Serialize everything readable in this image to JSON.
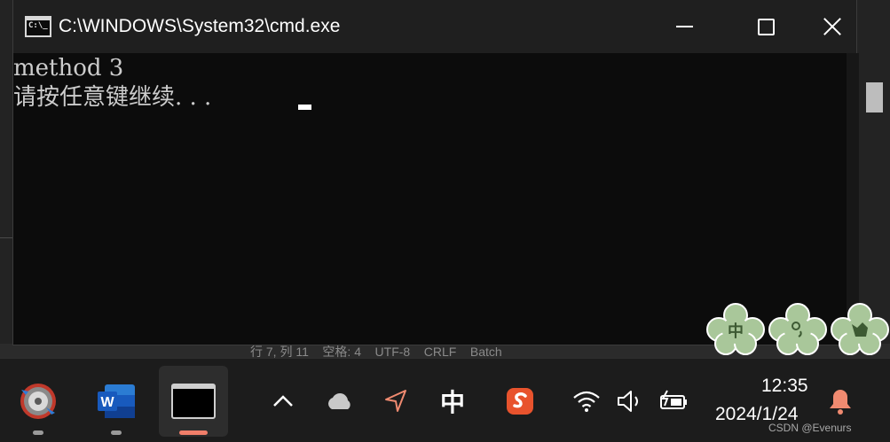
{
  "window": {
    "title": "C:\\WINDOWS\\System32\\cmd.exe",
    "icon_text": "C:\\_",
    "icon": "console-icon",
    "controls": [
      "minimize-icon",
      "maximize-icon",
      "close-icon"
    ]
  },
  "console": {
    "lines": [
      "method 3",
      "请按任意键继续. . . "
    ],
    "text_color": "#cccccc",
    "background": "#0c0c0c"
  },
  "background_status": "行 7, 列 11    空格: 4    UTF-8    CRLF    Batch",
  "stickers": [
    "中",
    "",
    ""
  ],
  "taskbar": {
    "apps": [
      {
        "name": "media-app-icon",
        "active": false
      },
      {
        "name": "word-icon",
        "label": "W",
        "active": false
      },
      {
        "name": "terminal-icon",
        "active": true
      }
    ],
    "tray": {
      "ime": "中",
      "icons": [
        "chevron-up-icon",
        "onedrive-cloud-icon",
        "location-arrow-icon",
        "ime-icon",
        "sogou-icon",
        "wifi-icon",
        "volume-icon",
        "battery-charging-icon",
        "notification-bell-icon"
      ]
    },
    "clock": {
      "time": "12:35",
      "date": "2024/1/24"
    },
    "accent": "#f07e6a"
  },
  "watermark": "CSDN @Evenurs"
}
